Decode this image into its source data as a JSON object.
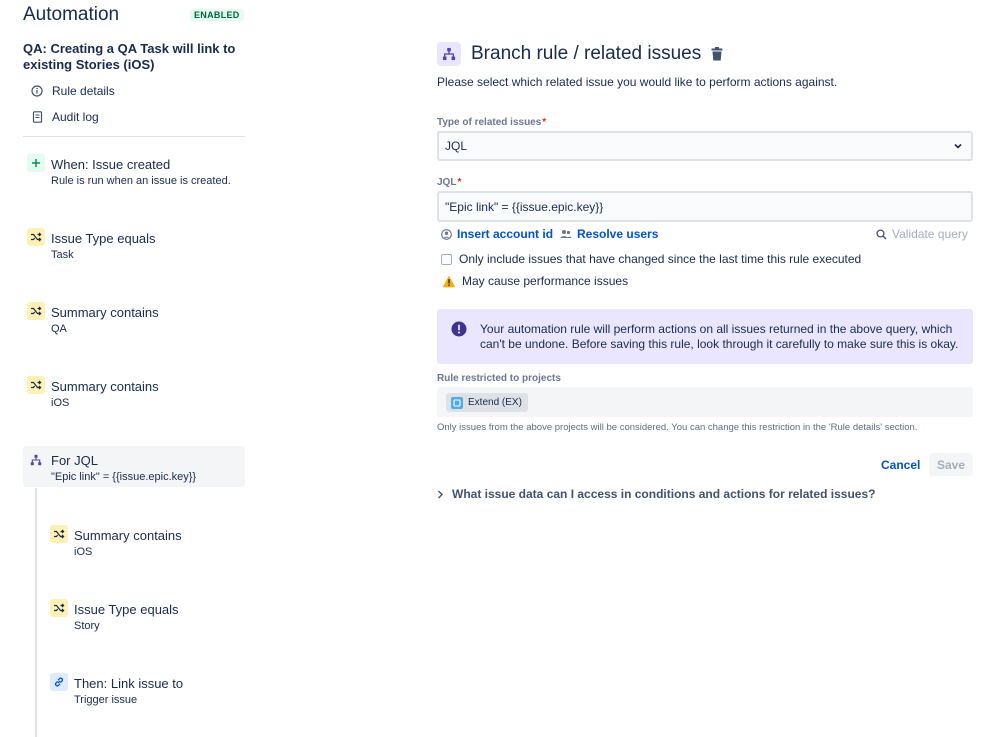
{
  "app": {
    "title": "Automation",
    "status_badge": "ENABLED"
  },
  "rule": {
    "name": "QA: Creating a QA Task will link to existing Stories (iOS)"
  },
  "nav": [
    {
      "label": "Rule details",
      "icon": "info-icon"
    },
    {
      "label": "Audit log",
      "icon": "document-icon"
    }
  ],
  "components": [
    {
      "title": "When: Issue created",
      "subtitle": "Rule is run when an issue is created.",
      "icon": "plus-icon",
      "kind": "trigger"
    },
    {
      "title": "Issue Type equals",
      "subtitle": "Task",
      "icon": "shuffle-icon",
      "kind": "condition"
    },
    {
      "title": "Summary contains",
      "subtitle": "QA",
      "icon": "shuffle-icon",
      "kind": "condition"
    },
    {
      "title": "Summary contains",
      "subtitle": "iOS",
      "icon": "shuffle-icon",
      "kind": "condition"
    },
    {
      "title": "For JQL",
      "subtitle": "\"Epic link\" = {{issue.epic.key}}",
      "icon": "branch-icon",
      "kind": "branch",
      "selected": true
    },
    {
      "title": "Summary contains",
      "subtitle": "iOS",
      "icon": "shuffle-icon",
      "kind": "condition"
    },
    {
      "title": "Issue Type equals",
      "subtitle": "Story",
      "icon": "shuffle-icon",
      "kind": "condition"
    },
    {
      "title": "Then: Link issue to",
      "subtitle": "Trigger issue",
      "icon": "link-icon",
      "kind": "action"
    }
  ],
  "panel": {
    "title": "Branch rule / related issues",
    "description": "Please select which related issue you would like to perform actions against.",
    "type_label": "Type of related issues",
    "type_value": "JQL",
    "jql_label": "JQL",
    "jql_value": "\"Epic link\" = {{issue.epic.key}}",
    "insert_account_id": "Insert account id",
    "resolve_users": "Resolve users",
    "validate_query": "Validate query",
    "checkbox_label": "Only include issues that have changed since the last time this rule executed",
    "checkbox_checked": false,
    "warning": "May cause performance issues",
    "info": "Your automation rule will perform actions on all issues returned in the above query, which can't be undone. Before saving this rule, look through it carefully to make sure this is okay.",
    "restricted_label": "Rule restricted to projects",
    "project_tag": "Extend (EX)",
    "projects_note": "Only issues from the above projects will be considered. You can change this restriction in the 'Rule details' section.",
    "cancel": "Cancel",
    "save": "Save",
    "expander": "What issue data can I access in conditions and actions for related issues?"
  },
  "colors": {
    "link": "#0052cc",
    "text": "#172b4d",
    "condition_bg": "#fff0b3",
    "trigger_bg": "#e3fcef",
    "branch_bg": "#eae6ff",
    "action_bg": "#deebff",
    "enabled_badge": "#006644",
    "warning": "#ffab00",
    "info_icon": "#403294"
  }
}
